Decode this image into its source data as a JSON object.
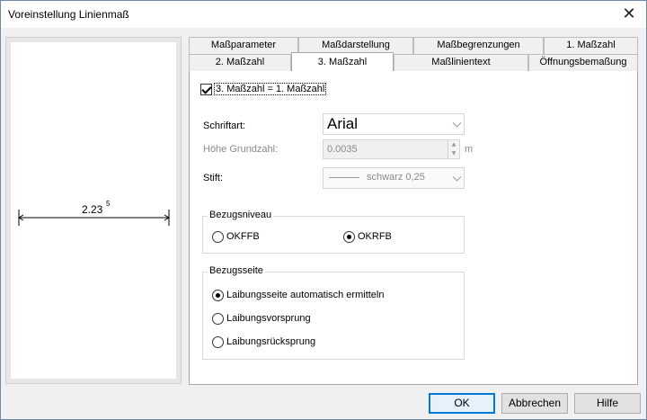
{
  "window": {
    "title": "Voreinstellung Linienmaß",
    "close_glyph": "✕"
  },
  "preview": {
    "dimension_text": "2.23",
    "dimension_sup": "5"
  },
  "tabs": {
    "row_back": [
      "Maßparameter",
      "Maßdarstellung",
      "Maßbegrenzungen",
      "1. Maßzahl"
    ],
    "row_front": [
      "2. Maßzahl",
      "3. Maßzahl",
      "Maßlinientext",
      "Öffnungsbemaßung"
    ],
    "active": "3. Maßzahl"
  },
  "panel": {
    "checkbox_label": "3. Maßzahl = 1. Maßzahl",
    "font_label": "Schriftart:",
    "font_value": "Arial",
    "height_label": "Höhe Grundzahl:",
    "height_value": "0.0035",
    "height_unit": "m",
    "pen_label": "Stift:",
    "pen_value": "schwarz 0,25",
    "bezugsniveau": {
      "title": "Bezugsniveau",
      "options": [
        "OKFFB",
        "OKRFB"
      ],
      "selected": "OKRFB"
    },
    "bezugsseite": {
      "title": "Bezugsseite",
      "options": [
        "Laibungsseite automatisch ermitteln",
        "Laibungsvorsprung",
        "Laibungsrücksprung"
      ],
      "selected": "Laibungsseite automatisch ermitteln"
    }
  },
  "buttons": {
    "ok": "OK",
    "cancel": "Abbrechen",
    "help": "Hilfe"
  }
}
